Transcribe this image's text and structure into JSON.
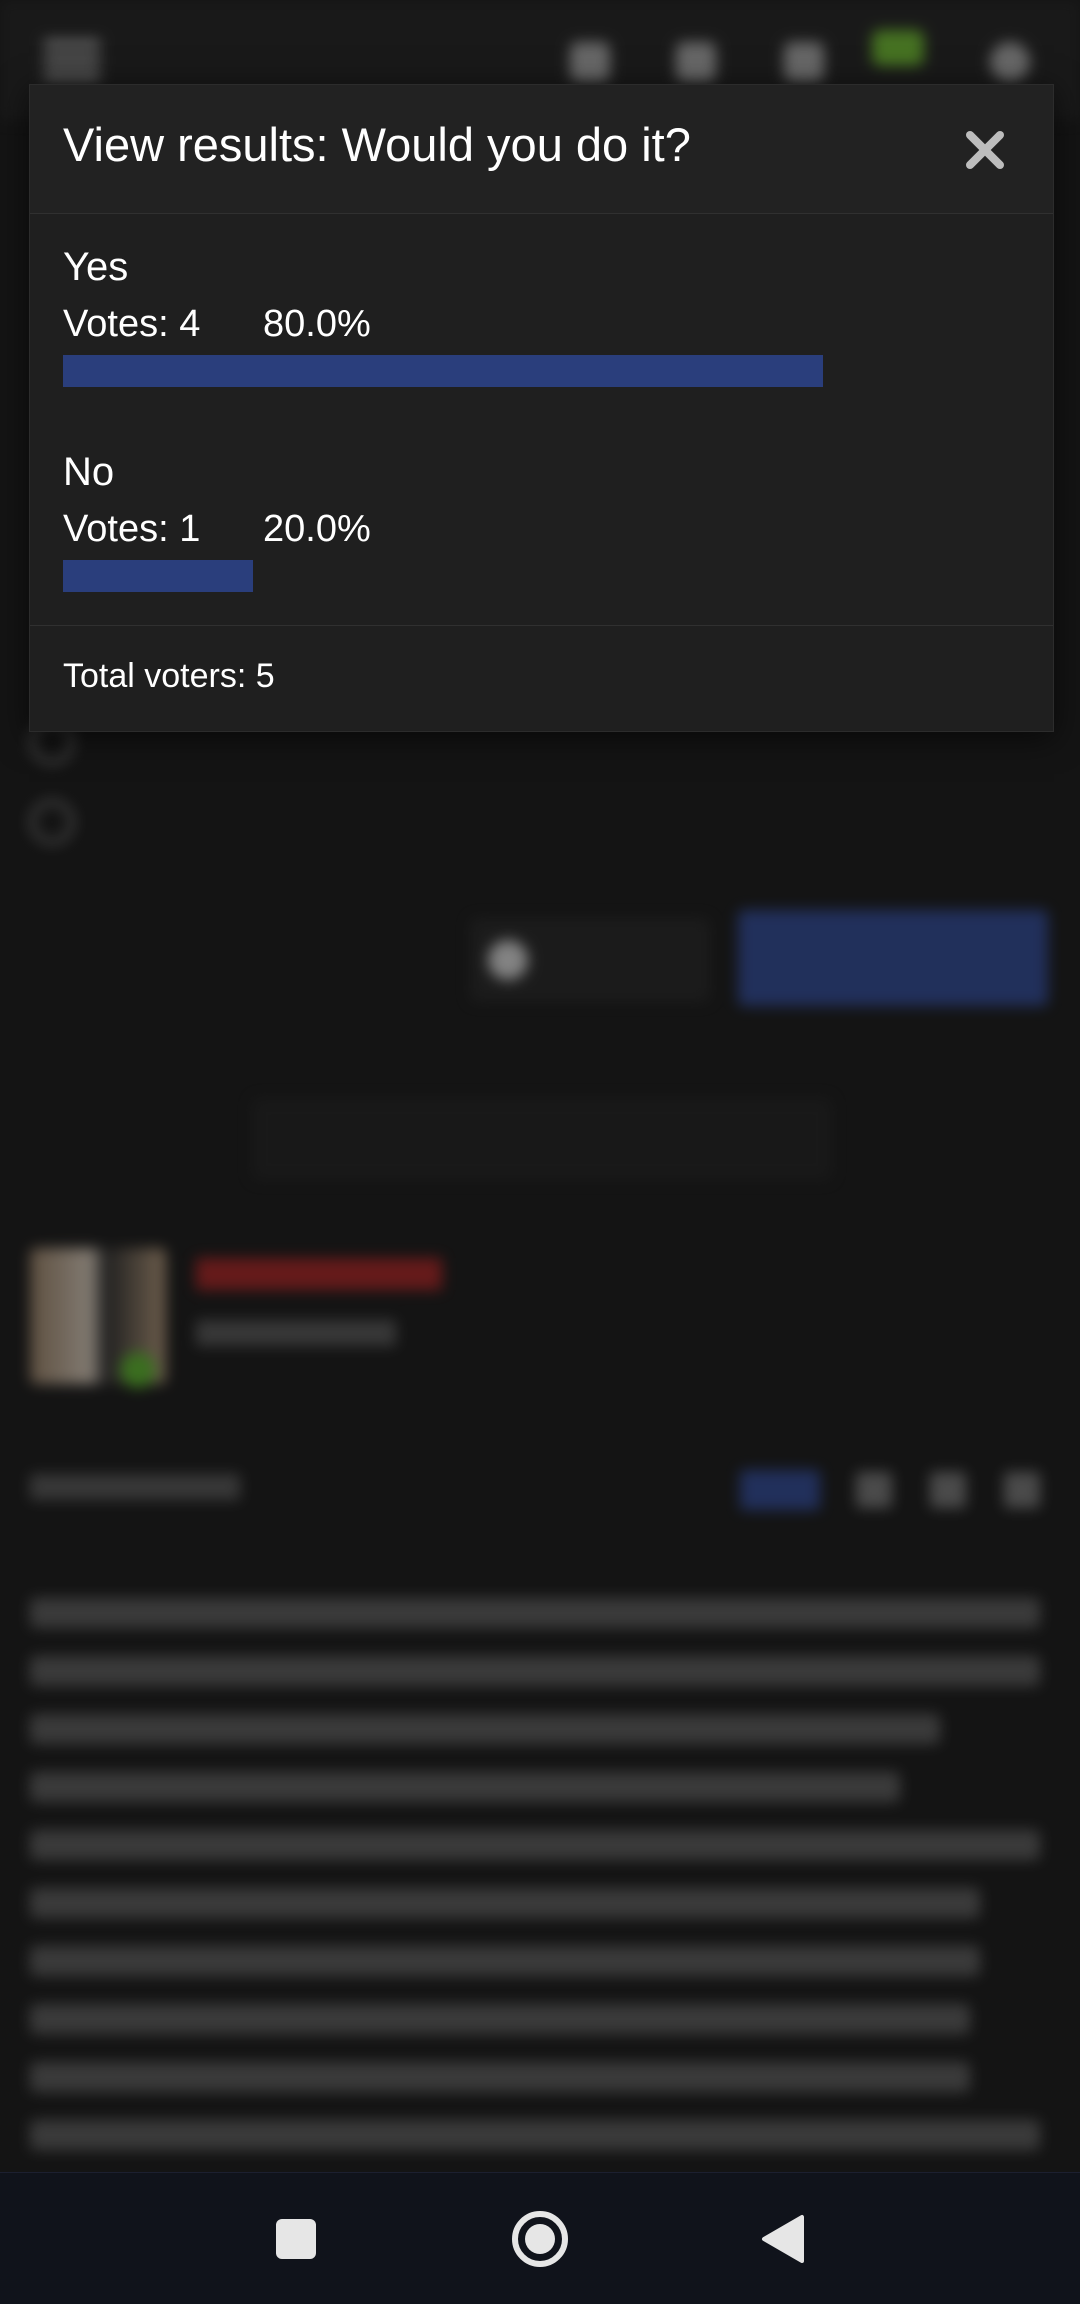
{
  "modal": {
    "title": "View results: Would you do it?",
    "options": [
      {
        "label": "Yes",
        "votes_text": "Votes: 4",
        "percent_text": "80.0%",
        "fraction": 0.8
      },
      {
        "label": "No",
        "votes_text": "Votes: 1",
        "percent_text": "20.0%",
        "fraction": 0.2
      }
    ],
    "total_text": "Total voters: 5",
    "bar_color": "#2a3e7c",
    "close_icon": "close-icon"
  },
  "navbar": {
    "recents_icon": "square-icon",
    "home_icon": "circle-home-icon",
    "back_icon": "triangle-back-icon"
  }
}
